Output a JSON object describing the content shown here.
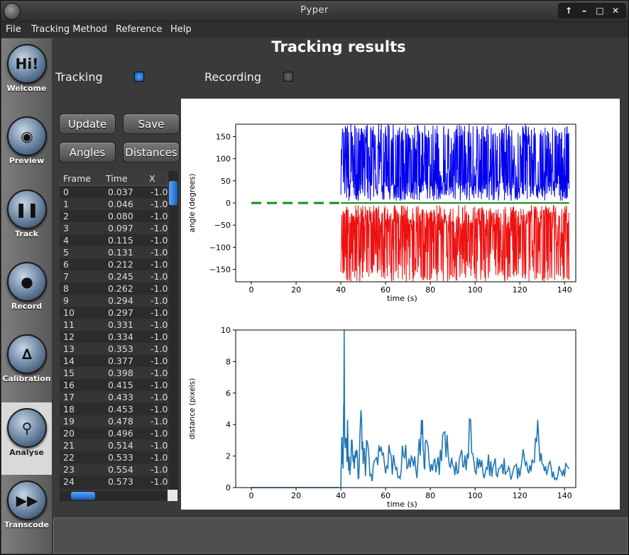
{
  "window": {
    "title": "Pyper"
  },
  "menu": [
    "File",
    "Tracking Method",
    "Reference",
    "Help"
  ],
  "sidebar": [
    {
      "label": "Welcome",
      "glyph": "Hi!"
    },
    {
      "label": "Preview",
      "glyph": "◉"
    },
    {
      "label": "Track",
      "glyph": "❚❚"
    },
    {
      "label": "Record",
      "glyph": "●"
    },
    {
      "label": "Calibration",
      "glyph": "∆"
    },
    {
      "label": "Analyse",
      "glyph": "⚲",
      "active": true
    },
    {
      "label": "Transcode",
      "glyph": "▶▶"
    }
  ],
  "page": {
    "title": "Tracking results",
    "tracking_label": "Tracking",
    "recording_label": "Recording",
    "tracking_on": true,
    "recording_on": false
  },
  "buttons": {
    "update": "Update",
    "save": "Save",
    "angles": "Angles",
    "distances": "Distances"
  },
  "table": {
    "columns": [
      "Frame",
      "Time",
      "X"
    ],
    "rows": [
      [
        "0",
        "0.037",
        "-1.0"
      ],
      [
        "1",
        "0.046",
        "-1.0"
      ],
      [
        "2",
        "0.080",
        "-1.0"
      ],
      [
        "3",
        "0.097",
        "-1.0"
      ],
      [
        "4",
        "0.115",
        "-1.0"
      ],
      [
        "5",
        "0.131",
        "-1.0"
      ],
      [
        "6",
        "0.212",
        "-1.0"
      ],
      [
        "7",
        "0.245",
        "-1.0"
      ],
      [
        "8",
        "0.262",
        "-1.0"
      ],
      [
        "9",
        "0.294",
        "-1.0"
      ],
      [
        "10",
        "0.297",
        "-1.0"
      ],
      [
        "11",
        "0.331",
        "-1.0"
      ],
      [
        "12",
        "0.334",
        "-1.0"
      ],
      [
        "13",
        "0.353",
        "-1.0"
      ],
      [
        "14",
        "0.377",
        "-1.0"
      ],
      [
        "15",
        "0.398",
        "-1.0"
      ],
      [
        "16",
        "0.415",
        "-1.0"
      ],
      [
        "17",
        "0.433",
        "-1.0"
      ],
      [
        "18",
        "0.453",
        "-1.0"
      ],
      [
        "19",
        "0.478",
        "-1.0"
      ],
      [
        "20",
        "0.496",
        "-1.0"
      ],
      [
        "21",
        "0.514",
        "-1.0"
      ],
      [
        "22",
        "0.533",
        "-1.0"
      ],
      [
        "23",
        "0.554",
        "-1.0"
      ],
      [
        "24",
        "0.573",
        "-1.0"
      ]
    ]
  },
  "chart_data": [
    {
      "type": "line",
      "xlabel": "time (s)",
      "ylabel": "angle (degrees)",
      "xlim": [
        -7,
        145
      ],
      "ylim": [
        -178,
        178
      ],
      "xticks": [
        0,
        20,
        40,
        60,
        80,
        100,
        120,
        140
      ],
      "yticks": [
        150,
        100,
        50,
        0,
        -50,
        -100,
        -150
      ],
      "series": [
        {
          "style": "dashed",
          "color": "#1a8a1a",
          "segment": [
            [
              0,
              0
            ],
            [
              40,
              0
            ]
          ]
        },
        {
          "color": "#0000ee",
          "x_range": [
            40,
            142
          ],
          "y_range": [
            0,
            178
          ]
        },
        {
          "color": "#ee1111",
          "x_range": [
            40,
            142
          ],
          "y_range": [
            -178,
            0
          ]
        },
        {
          "color": "#1a8a1a",
          "segment": [
            [
              40,
              0
            ],
            [
              142,
              0
            ]
          ]
        }
      ]
    },
    {
      "type": "line",
      "xlabel": "time (s)",
      "ylabel": "distance (pixels)",
      "xlim": [
        -7,
        145
      ],
      "ylim": [
        0,
        10
      ],
      "xticks": [
        0,
        20,
        40,
        60,
        80,
        100,
        120,
        140
      ],
      "yticks": [
        10,
        8,
        6,
        4,
        2,
        0
      ],
      "series": [
        {
          "color": "#1f77b4",
          "baseline": {
            "x_range": [
              0,
              39
            ],
            "y": 0
          },
          "points": [
            [
              40,
              0
            ],
            [
              40.5,
              3.2
            ],
            [
              41,
              1.2
            ],
            [
              41.5,
              10
            ],
            [
              42,
              2.5
            ],
            [
              43,
              4.3
            ],
            [
              44,
              0.8
            ],
            [
              45,
              3.0
            ],
            [
              46,
              1.2
            ],
            [
              47,
              2.4
            ],
            [
              48,
              0.6
            ],
            [
              49,
              4.9
            ],
            [
              50,
              1.5
            ],
            [
              52,
              2.8
            ],
            [
              54,
              0.4
            ],
            [
              56,
              1.9
            ],
            [
              58,
              2.6
            ],
            [
              60,
              0.9
            ],
            [
              62,
              2.2
            ],
            [
              64,
              1.6
            ],
            [
              66,
              0.7
            ],
            [
              68,
              2.0
            ],
            [
              70,
              1.3
            ],
            [
              72,
              1.8
            ],
            [
              74,
              0.6
            ],
            [
              76,
              4.3
            ],
            [
              77,
              2.2
            ],
            [
              78,
              3.0
            ],
            [
              80,
              1.0
            ],
            [
              82,
              1.8
            ],
            [
              84,
              0.8
            ],
            [
              86,
              3.5
            ],
            [
              88,
              2.0
            ],
            [
              90,
              1.4
            ],
            [
              92,
              0.9
            ],
            [
              94,
              2.4
            ],
            [
              96,
              1.1
            ],
            [
              98,
              4.3
            ],
            [
              100,
              1.0
            ],
            [
              102,
              1.8
            ],
            [
              104,
              0.6
            ],
            [
              106,
              2.1
            ],
            [
              108,
              1.3
            ],
            [
              110,
              0.7
            ],
            [
              112,
              1.5
            ],
            [
              114,
              1.0
            ],
            [
              116,
              0.5
            ],
            [
              118,
              1.4
            ],
            [
              120,
              0.7
            ],
            [
              122,
              1.9
            ],
            [
              124,
              0.9
            ],
            [
              126,
              1.6
            ],
            [
              128,
              4.3
            ],
            [
              130,
              1.5
            ],
            [
              132,
              0.8
            ],
            [
              134,
              1.3
            ],
            [
              136,
              0.6
            ],
            [
              138,
              1.1
            ],
            [
              140,
              0.7
            ],
            [
              142,
              1.2
            ]
          ]
        }
      ]
    }
  ],
  "colors": {
    "accent": "#1a5db8",
    "window_bg": "#3a3a3a",
    "active_nav": "#d9d9d9"
  }
}
